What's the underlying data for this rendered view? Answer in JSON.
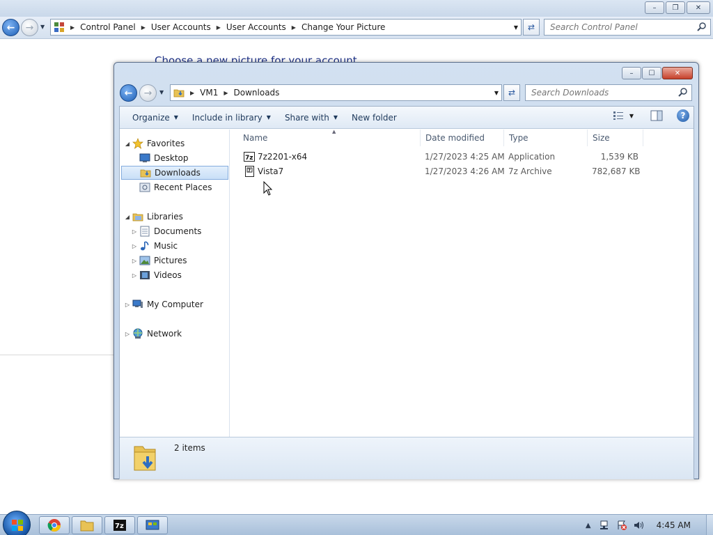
{
  "control_panel": {
    "breadcrumbs": [
      "Control Panel",
      "User Accounts",
      "User Accounts",
      "Change Your Picture"
    ],
    "search_placeholder": "Search Control Panel",
    "heading": "Choose a new picture for your account"
  },
  "explorer": {
    "breadcrumbs": [
      "VM1",
      "Downloads"
    ],
    "search_placeholder": "Search Downloads",
    "toolbar": {
      "organize": "Organize",
      "include_in_library": "Include in library",
      "share_with": "Share with",
      "new_folder": "New folder"
    },
    "nav": {
      "favorites": "Favorites",
      "desktop": "Desktop",
      "downloads": "Downloads",
      "recent_places": "Recent Places",
      "libraries": "Libraries",
      "documents": "Documents",
      "music": "Music",
      "pictures": "Pictures",
      "videos": "Videos",
      "my_computer": "My Computer",
      "network": "Network"
    },
    "columns": {
      "name": "Name",
      "date_modified": "Date modified",
      "type": "Type",
      "size": "Size"
    },
    "files": [
      {
        "name": "7z2201-x64",
        "date": "1/27/2023 4:25 AM",
        "type": "Application",
        "size": "1,539 KB"
      },
      {
        "name": "Vista7",
        "date": "1/27/2023 4:26 AM",
        "type": "7z Archive",
        "size": "782,687 KB"
      }
    ],
    "status": "2 items"
  },
  "taskbar": {
    "clock": "4:45 AM",
    "apps": [
      "chrome-icon",
      "explorer-icon",
      "7zip-icon",
      "control-panel-icon"
    ]
  },
  "colors": {
    "accent": "#1d5fb6",
    "selection": "#c9dff7",
    "heading": "#1e3287"
  }
}
